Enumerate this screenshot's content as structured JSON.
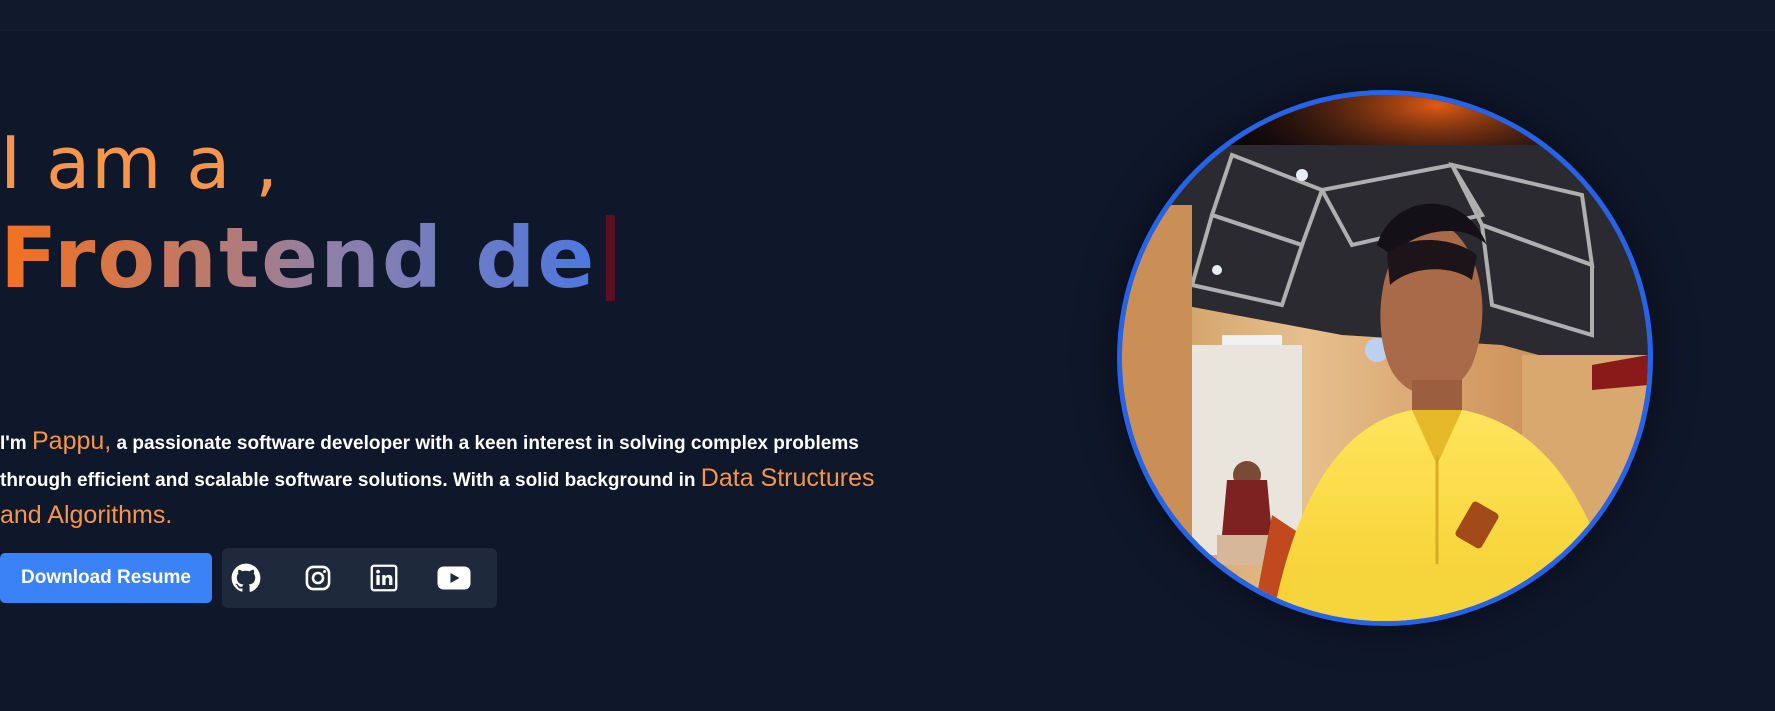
{
  "hero": {
    "greeting": "I am a ,",
    "role_typed": "Frontend de",
    "intro": {
      "prefix": "I'm ",
      "name": "Pappu,",
      "middle": " a passionate software developer with a keen interest in solving complex problems through efficient and scalable software solutions. With a solid background in ",
      "highlight": "Data Structures and Algorithms."
    },
    "resume_button": "Download Resume"
  },
  "socials": [
    {
      "icon": "github-icon"
    },
    {
      "icon": "instagram-icon"
    },
    {
      "icon": "linkedin-icon"
    },
    {
      "icon": "youtube-icon"
    }
  ],
  "colors": {
    "background": "#0f172a",
    "accent_orange": "#f7964a",
    "button_blue": "#3b82f6",
    "photo_border": "#2563eb",
    "social_bar": "#1e293b"
  }
}
